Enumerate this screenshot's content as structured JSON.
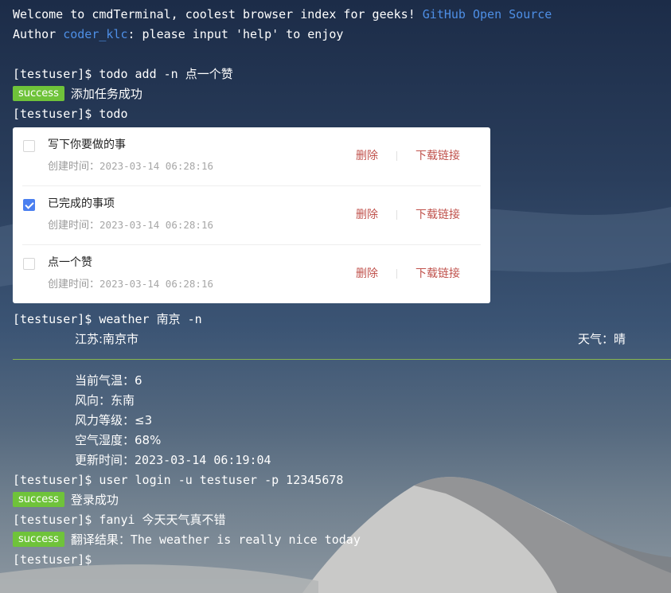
{
  "header": {
    "welcome": "Welcome to cmdTerminal, coolest browser index for geeks!",
    "github_link": "GitHub Open Source",
    "author_prefix": "Author",
    "author_link": "coder_klc",
    "author_suffix": ": please input 'help' to enjoy"
  },
  "prompt": "[testuser]$",
  "commands": {
    "c1": "todo add -n 点一个赞",
    "c1_result": "添加任务成功",
    "c2": "todo",
    "c3": "weather 南京 -n",
    "c4": "user login -u testuser -p 12345678",
    "c4_result": "登录成功",
    "c5": "fanyi 今天天气真不错",
    "c5_result": "翻译结果：The weather is really nice today"
  },
  "success_label": "success",
  "todos": [
    {
      "title": "写下你要做的事",
      "time_label": "创建时间：",
      "time": "2023-03-14 06:28:16",
      "checked": false
    },
    {
      "title": "已完成的事项",
      "time_label": "创建时间：",
      "time": "2023-03-14 06:28:16",
      "checked": true
    },
    {
      "title": "点一个赞",
      "time_label": "创建时间：",
      "time": "2023-03-14 06:28:16",
      "checked": false
    }
  ],
  "todo_actions": {
    "delete": "删除",
    "download": "下载链接"
  },
  "weather": {
    "location": "江苏:南京市",
    "condition": "天气：晴",
    "temperature": "当前气温：6",
    "wind_dir": "风向：东南",
    "wind_level": "风力等级：≤3",
    "humidity": "空气湿度：68%",
    "updated": "更新时间：2023-03-14 06:19:04"
  },
  "colors": {
    "success": "#6fc33a",
    "link": "#4e8fe6",
    "action": "#c0524c",
    "checkbox": "#4a7ff0"
  }
}
